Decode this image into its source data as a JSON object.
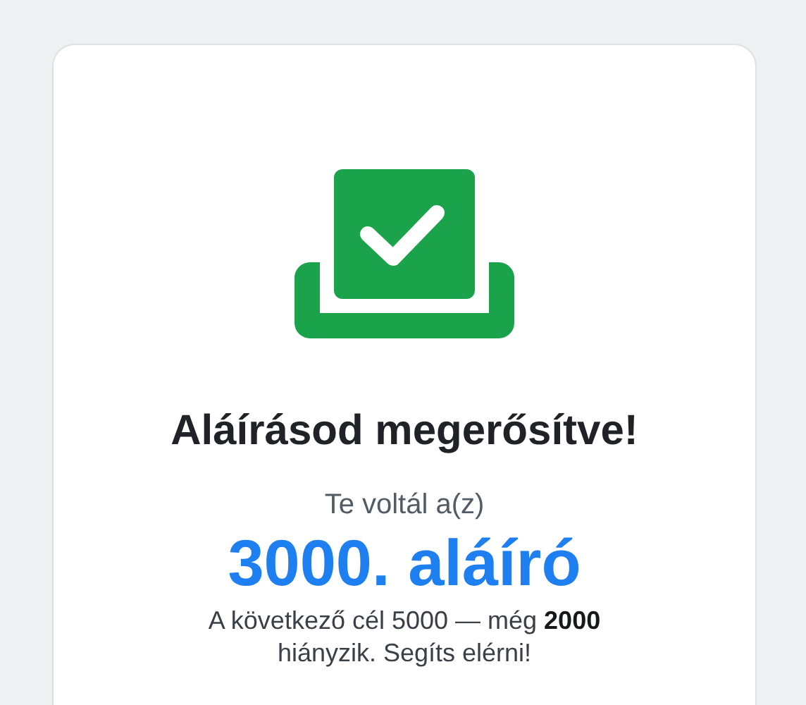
{
  "card": {
    "title": "Aláírásod megerősítve!",
    "subtitle": "Te voltál a(z)",
    "count": "3000. aláíró",
    "note": "A következő cél 5000 — még **2000** hiányzik. Segíts elérni!"
  }
}
